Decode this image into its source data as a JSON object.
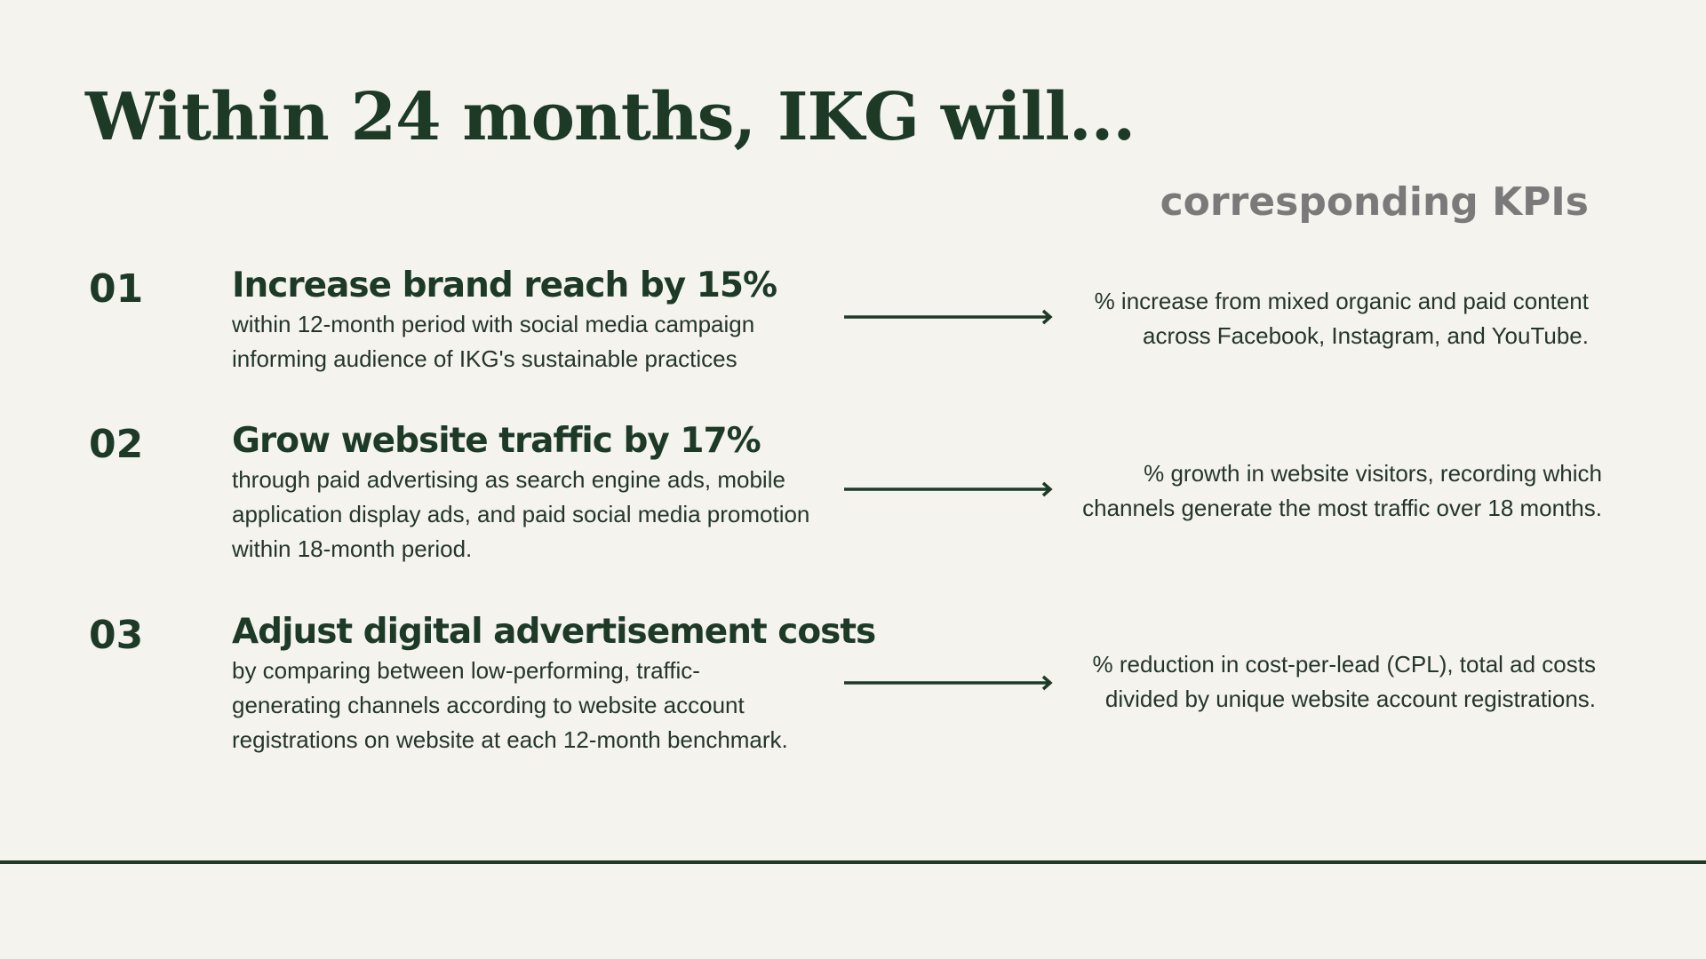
{
  "slide": {
    "title": "Within 24 months, IKG will...",
    "kpi_heading": "corresponding KPIs"
  },
  "goals": [
    {
      "number": "01",
      "headline": "Increase brand reach by 15%",
      "description": "within 12-month period with social media campaign\ninforming audience of IKG's sustainable practices",
      "kpi": "% increase from mixed organic and paid content\nacross Facebook, Instagram, and YouTube."
    },
    {
      "number": "02",
      "headline": "Grow website traffic by 17%",
      "description": "through paid advertising as search engine ads, mobile\napplication display ads, and paid social media promotion\nwithin 18-month period.",
      "kpi": "% growth in website visitors, recording which\nchannels generate the most traffic over 18 months."
    },
    {
      "number": "03",
      "headline": "Adjust digital advertisement costs",
      "description": "by comparing between low-performing, traffic-\ngenerating channels according to website account\nregistrations on website at each 12-month benchmark.",
      "kpi": "% reduction in cost-per-lead (CPL), total ad costs\ndivided by unique website account registrations."
    }
  ],
  "colors": {
    "background": "#f5f3ee",
    "primary": "#1d3a27",
    "muted": "#7a7a7a"
  },
  "icons": {
    "arrow": "arrow-right-icon"
  }
}
